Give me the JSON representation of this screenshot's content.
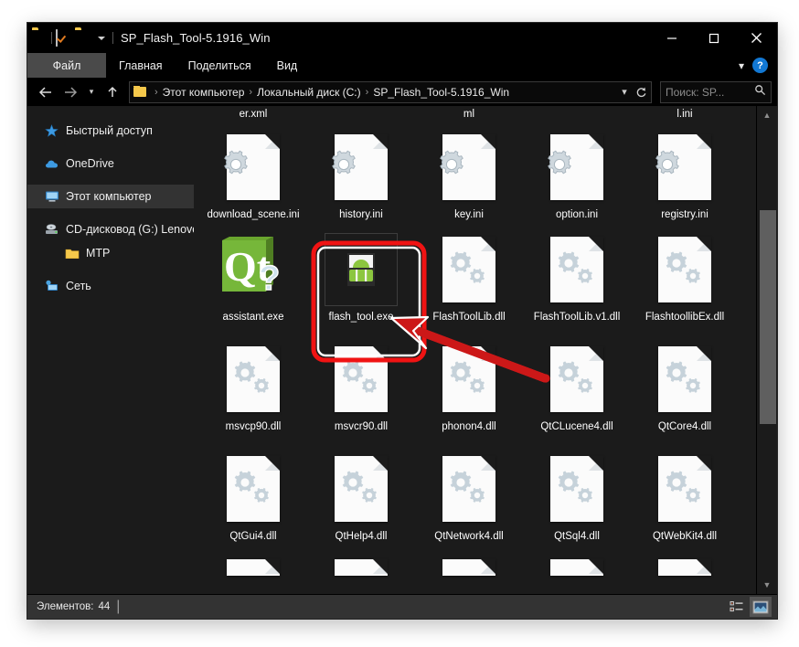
{
  "window": {
    "title": "SP_Flash_Tool-5.1916_Win",
    "quick_access_icons": [
      "folder-icon",
      "properties-checklist-icon",
      "new-folder-icon",
      "customize-caret-icon"
    ],
    "controls": {
      "minimize": "minimize-icon",
      "maximize": "maximize-icon",
      "close": "close-icon"
    }
  },
  "ribbon": {
    "tabs": [
      {
        "label": "Файл",
        "selected": true
      },
      {
        "label": "Главная",
        "selected": false
      },
      {
        "label": "Поделиться",
        "selected": false
      },
      {
        "label": "Вид",
        "selected": false
      }
    ],
    "collapse_icon": "chevron-down-icon",
    "help_label": "?"
  },
  "addressbar": {
    "back_icon": "arrow-left-icon",
    "forward_icon": "arrow-right-icon",
    "recent_icon": "chevron-down-icon",
    "up_icon": "arrow-up-icon",
    "breadcrumbs": [
      "Этот компьютер",
      "Локальный диск (C:)",
      "SP_Flash_Tool-5.1916_Win"
    ],
    "separator": "›",
    "dropdown_icon": "chevron-down-icon",
    "refresh_icon": "refresh-icon",
    "search_placeholder": "Поиск: SP...",
    "search_icon": "search-icon"
  },
  "sidebar": {
    "items": [
      {
        "label": "Быстрый доступ",
        "icon": "star-icon",
        "selected": false,
        "indent": false
      },
      {
        "label": "OneDrive",
        "icon": "cloud-icon",
        "selected": false,
        "indent": false
      },
      {
        "label": "Этот компьютер",
        "icon": "computer-icon",
        "selected": true,
        "indent": false
      },
      {
        "label": "CD-дисковод (G:) Lenovo",
        "icon": "cd-drive-icon",
        "selected": false,
        "indent": false
      },
      {
        "label": "MTP",
        "icon": "folder-icon",
        "selected": false,
        "indent": true
      },
      {
        "label": "Сеть",
        "icon": "network-icon",
        "selected": false,
        "indent": false
      }
    ]
  },
  "files": {
    "clipped_top_row": [
      "er.xml",
      "",
      "ml",
      "",
      "l.ini"
    ],
    "rows": [
      [
        {
          "name": "download_scene.ini",
          "type": "ini",
          "selected": false
        },
        {
          "name": "history.ini",
          "type": "ini",
          "selected": false
        },
        {
          "name": "key.ini",
          "type": "ini",
          "selected": false
        },
        {
          "name": "option.ini",
          "type": "ini",
          "selected": false
        },
        {
          "name": "registry.ini",
          "type": "ini",
          "selected": false
        }
      ],
      [
        {
          "name": "assistant.exe",
          "type": "qt-exe",
          "selected": false
        },
        {
          "name": "flash_tool.exe",
          "type": "android-exe",
          "selected": true
        },
        {
          "name": "FlashToolLib.dll",
          "type": "dll",
          "selected": false
        },
        {
          "name": "FlashToolLib.v1.dll",
          "type": "dll",
          "selected": false
        },
        {
          "name": "FlashtoollibEx.dll",
          "type": "dll",
          "selected": false
        }
      ],
      [
        {
          "name": "msvcp90.dll",
          "type": "dll",
          "selected": false
        },
        {
          "name": "msvcr90.dll",
          "type": "dll",
          "selected": false
        },
        {
          "name": "phonon4.dll",
          "type": "dll",
          "selected": false
        },
        {
          "name": "QtCLucene4.dll",
          "type": "dll",
          "selected": false
        },
        {
          "name": "QtCore4.dll",
          "type": "dll",
          "selected": false
        }
      ],
      [
        {
          "name": "QtGui4.dll",
          "type": "dll",
          "selected": false
        },
        {
          "name": "QtHelp4.dll",
          "type": "dll",
          "selected": false
        },
        {
          "name": "QtNetwork4.dll",
          "type": "dll",
          "selected": false
        },
        {
          "name": "QtSql4.dll",
          "type": "dll",
          "selected": false
        },
        {
          "name": "QtWebKit4.dll",
          "type": "dll",
          "selected": false
        }
      ]
    ]
  },
  "statusbar": {
    "items_label": "Элементов:",
    "items_count": "44",
    "separator": "|",
    "details_view_icon": "details-view-icon",
    "large_icons_view_icon": "large-icons-view-icon"
  },
  "annotation": {
    "highlight_color": "#f01313",
    "arrow_name": "red-callout-arrow",
    "highlight_target": "flash_tool.exe"
  }
}
